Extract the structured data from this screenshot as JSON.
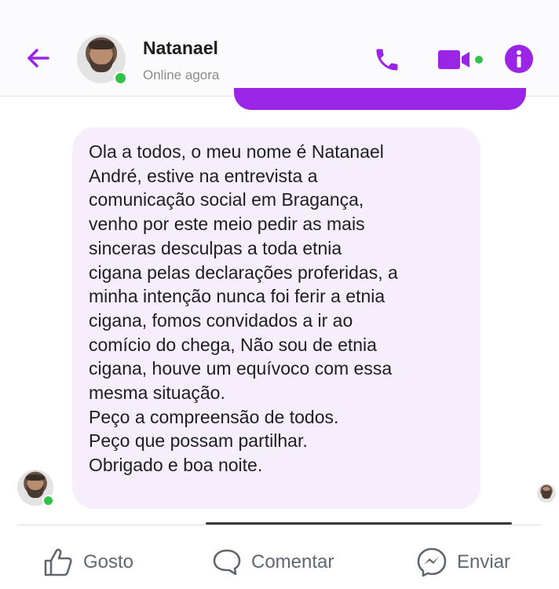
{
  "header": {
    "contact_name": "Natanael",
    "status_text": "Online agora",
    "icons": [
      "back-arrow-icon",
      "phone-icon",
      "video-camera-icon",
      "info-icon"
    ],
    "accent_color": "#9b25e6"
  },
  "message": {
    "text": "Ola a todos, o meu nome é Natanael\nAndré, estive na entrevista a\ncomunicação social em Bragança,\nvenho por este meio pedir as mais\nsinceras desculpas a toda etnia\ncigana pelas declarações proferidas, a\nminha intenção nunca foi ferir a etnia\ncigana, fomos convidados a ir ao\ncomício do chega, Não sou de etnia\ncigana, houve um equívoco com essa\nmesma situação.\nPeço a compreensão de todos.\nPeço que possam partilhar.\nObrigado e boa noite.",
    "bubble_color": "#f7eefb"
  },
  "actions": {
    "like_label": "Gosto",
    "comment_label": "Comentar",
    "send_label": "Enviar"
  }
}
